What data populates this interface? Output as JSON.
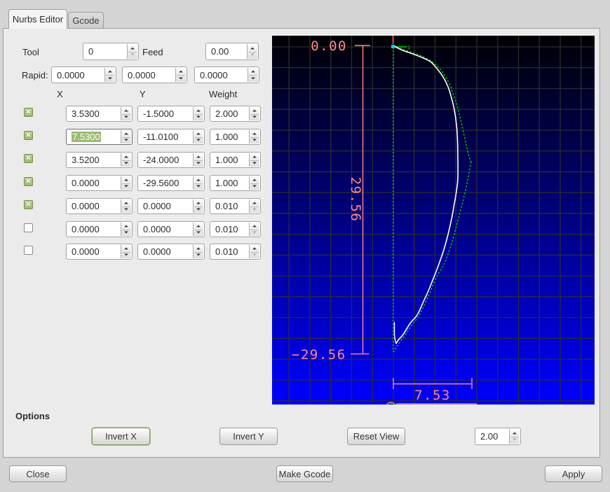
{
  "tabs": [
    {
      "label": "Nurbs Editor",
      "active": true
    },
    {
      "label": "Gcode",
      "active": false
    }
  ],
  "header": {
    "tool_label": "Tool",
    "tool_value": "0",
    "feed_label": "Feed",
    "feed_value": "0.00",
    "rapid_label": "Rapid:",
    "rapid_values": [
      "0.0000",
      "0.0000",
      "0.0000"
    ]
  },
  "columns": {
    "x": "X",
    "y": "Y",
    "weight": "Weight"
  },
  "points": [
    {
      "enabled": true,
      "x": "3.5300",
      "y": "-1.5000",
      "weight": "2.000",
      "selected": false
    },
    {
      "enabled": true,
      "x": "7.5300",
      "y": "-11.0100",
      "weight": "1.000",
      "selected": true
    },
    {
      "enabled": true,
      "x": "3.5200",
      "y": "-24.0000",
      "weight": "1.000",
      "selected": false
    },
    {
      "enabled": true,
      "x": "0.0000",
      "y": "-29.5600",
      "weight": "1.000",
      "selected": false
    },
    {
      "enabled": true,
      "x": "0.0000",
      "y": "0.0000",
      "weight": "0.010",
      "selected": false
    },
    {
      "enabled": false,
      "x": "0.0000",
      "y": "0.0000",
      "weight": "0.010",
      "selected": false
    },
    {
      "enabled": false,
      "x": "0.0000",
      "y": "0.0000",
      "weight": "0.010",
      "selected": false
    }
  ],
  "plot": {
    "labels": {
      "top": "0.00",
      "height": "29.56",
      "bottom": "−29.56",
      "width": "7.53"
    },
    "marker_index": "1",
    "colors": {
      "dimension": "#ff8a8a",
      "curve": "#ffffff",
      "control_polygon": "#00d400",
      "point_marker": "#00d4e8",
      "grid": "#2d2d2d",
      "background_top": "#000000",
      "background_bottom": "#0000ff"
    }
  },
  "options": {
    "title": "Options",
    "invert_x": "Invert X",
    "invert_y": "Invert Y",
    "reset_view": "Reset View",
    "scale_value": "2.00"
  },
  "actions": {
    "close": "Close",
    "make_gcode": "Make Gcode",
    "apply": "Apply"
  }
}
